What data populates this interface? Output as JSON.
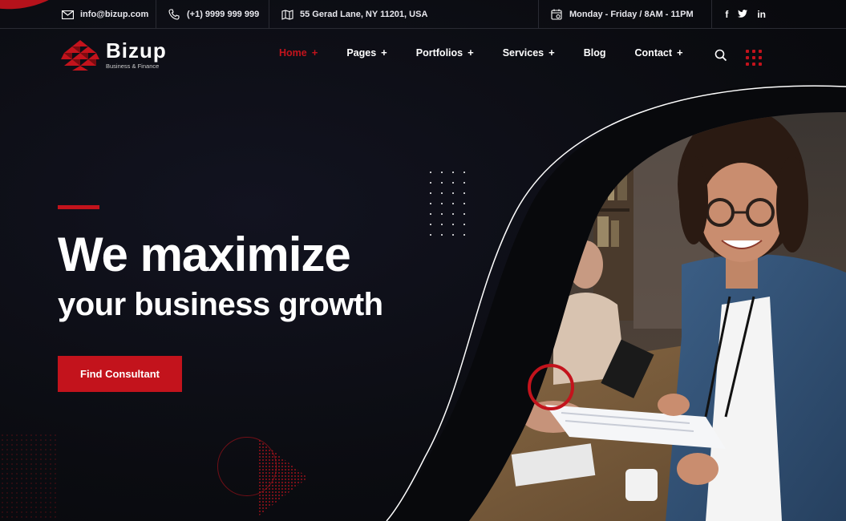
{
  "topbar": {
    "email": "info@bizup.com",
    "phone": "(+1) 9999 999 999",
    "address": "55 Gerad Lane, NY 11201, USA",
    "hours": "Monday - Friday / 8AM - 11PM",
    "social": [
      "f",
      "t",
      "in"
    ]
  },
  "brand": {
    "name": "Bizup",
    "tagline": "Business & Finance"
  },
  "nav": {
    "items": [
      {
        "label": "Home",
        "has_sub": true,
        "active": true
      },
      {
        "label": "Pages",
        "has_sub": true
      },
      {
        "label": "Portfolios",
        "has_sub": true
      },
      {
        "label": "Services",
        "has_sub": true
      },
      {
        "label": "Blog",
        "has_sub": false
      },
      {
        "label": "Contact",
        "has_sub": true
      }
    ],
    "plus": "+"
  },
  "hero": {
    "title_line1": "We maximize",
    "title_line2": "your business growth",
    "cta_label": "Find Consultant"
  },
  "colors": {
    "accent": "#c3131c",
    "background": "#0b0c11"
  },
  "icons": [
    "envelope-icon",
    "phone-icon",
    "map-icon",
    "calendar-icon",
    "search-icon",
    "grid-menu-icon"
  ]
}
